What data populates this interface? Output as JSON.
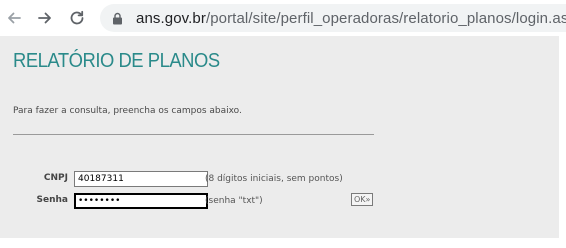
{
  "browser": {
    "url_domain": "ans.gov.br",
    "url_path": "/portal/site/perfil_operadoras/relatorio_planos/login.asp"
  },
  "page": {
    "title": "RELATÓRIO DE PLANOS",
    "instruction": "Para fazer a consulta, preencha os campos abaixo."
  },
  "form": {
    "cnpj_label": "CNPJ",
    "cnpj_value": "40187311",
    "cnpj_hint": "(8 dígitos iniciais, sem pontos)",
    "senha_label": "Senha",
    "senha_value": "••••••••",
    "senha_hint": "(senha \"txt\")",
    "ok_label": "OK»"
  },
  "colors": {
    "title": "#2a8a8a",
    "page_background": "#ececec"
  }
}
